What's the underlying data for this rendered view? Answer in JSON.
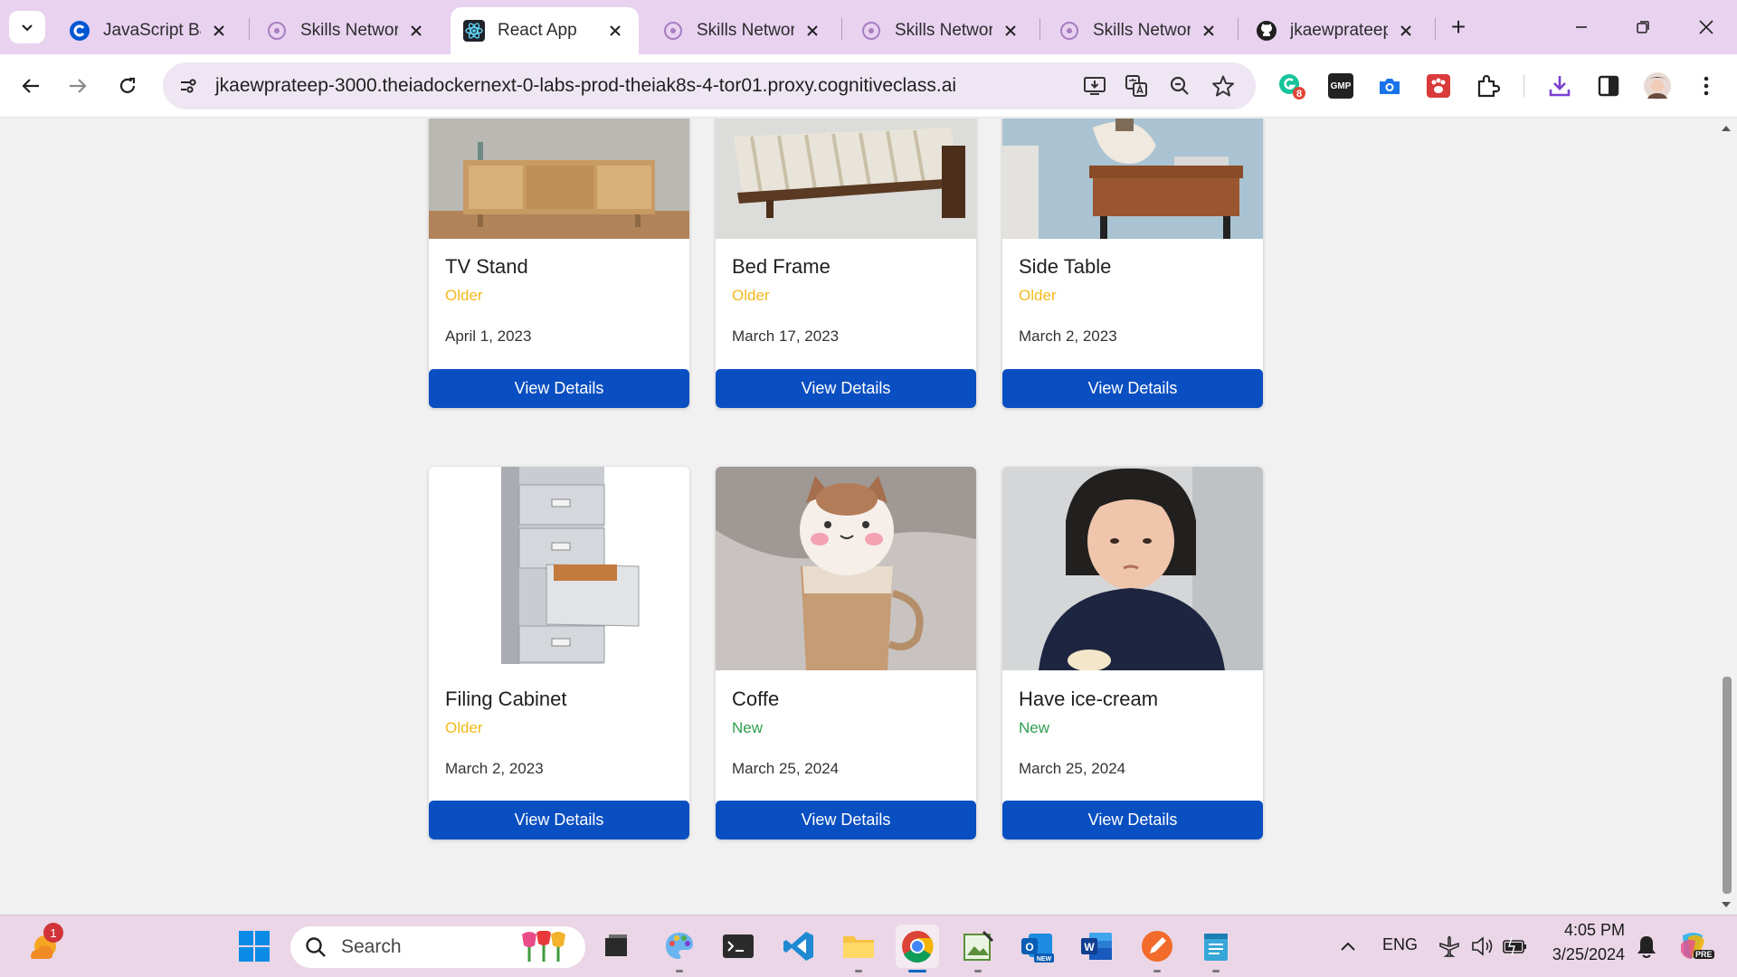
{
  "browser": {
    "tabs": [
      {
        "title": "JavaScript Bac",
        "icon": "coursera-icon",
        "active": false
      },
      {
        "title": "Skills Network",
        "icon": "skills-network-icon",
        "active": false
      },
      {
        "title": "React App",
        "icon": "react-icon",
        "active": true
      },
      {
        "title": "Skills Network",
        "icon": "skills-network-icon",
        "active": false
      },
      {
        "title": "Skills Network",
        "icon": "skills-network-icon",
        "active": false
      },
      {
        "title": "Skills Network",
        "icon": "skills-network-icon",
        "active": false
      },
      {
        "title": "jkaewprateep/",
        "icon": "github-icon",
        "active": false
      }
    ],
    "new_tab_label": "+",
    "url": "jkaewprateep-3000.theiadockernext-0-labs-prod-theiak8s-4-tor01.proxy.cognitiveclass.ai",
    "extension_badge": "8",
    "gmp_label": "GMP"
  },
  "page": {
    "cards": [
      {
        "title": "TV Stand",
        "status": "Older",
        "date": "April 1, 2023",
        "button": "View Details",
        "image": "tv-stand-image"
      },
      {
        "title": "Bed Frame",
        "status": "Older",
        "date": "March 17, 2023",
        "button": "View Details",
        "image": "bed-frame-image"
      },
      {
        "title": "Side Table",
        "status": "Older",
        "date": "March 2, 2023",
        "button": "View Details",
        "image": "side-table-image"
      },
      {
        "title": "Filing Cabinet",
        "status": "Older",
        "date": "March 2, 2023",
        "button": "View Details",
        "image": "filing-cabinet-image"
      },
      {
        "title": "Coffe",
        "status": "New",
        "date": "March 25, 2024",
        "button": "View Details",
        "image": "coffee-image"
      },
      {
        "title": "Have ice-cream",
        "status": "New",
        "date": "March 25, 2024",
        "button": "View Details",
        "image": "child-photo-image"
      }
    ],
    "colors": {
      "older": "#f5b91c",
      "new": "#2e9e4f",
      "button": "#0a4fc1"
    }
  },
  "taskbar": {
    "weather_badge": "1",
    "search_placeholder": "Search",
    "language": "ENG",
    "time": "4:05 PM",
    "date": "3/25/2024",
    "copilot_badge": "PRE"
  }
}
